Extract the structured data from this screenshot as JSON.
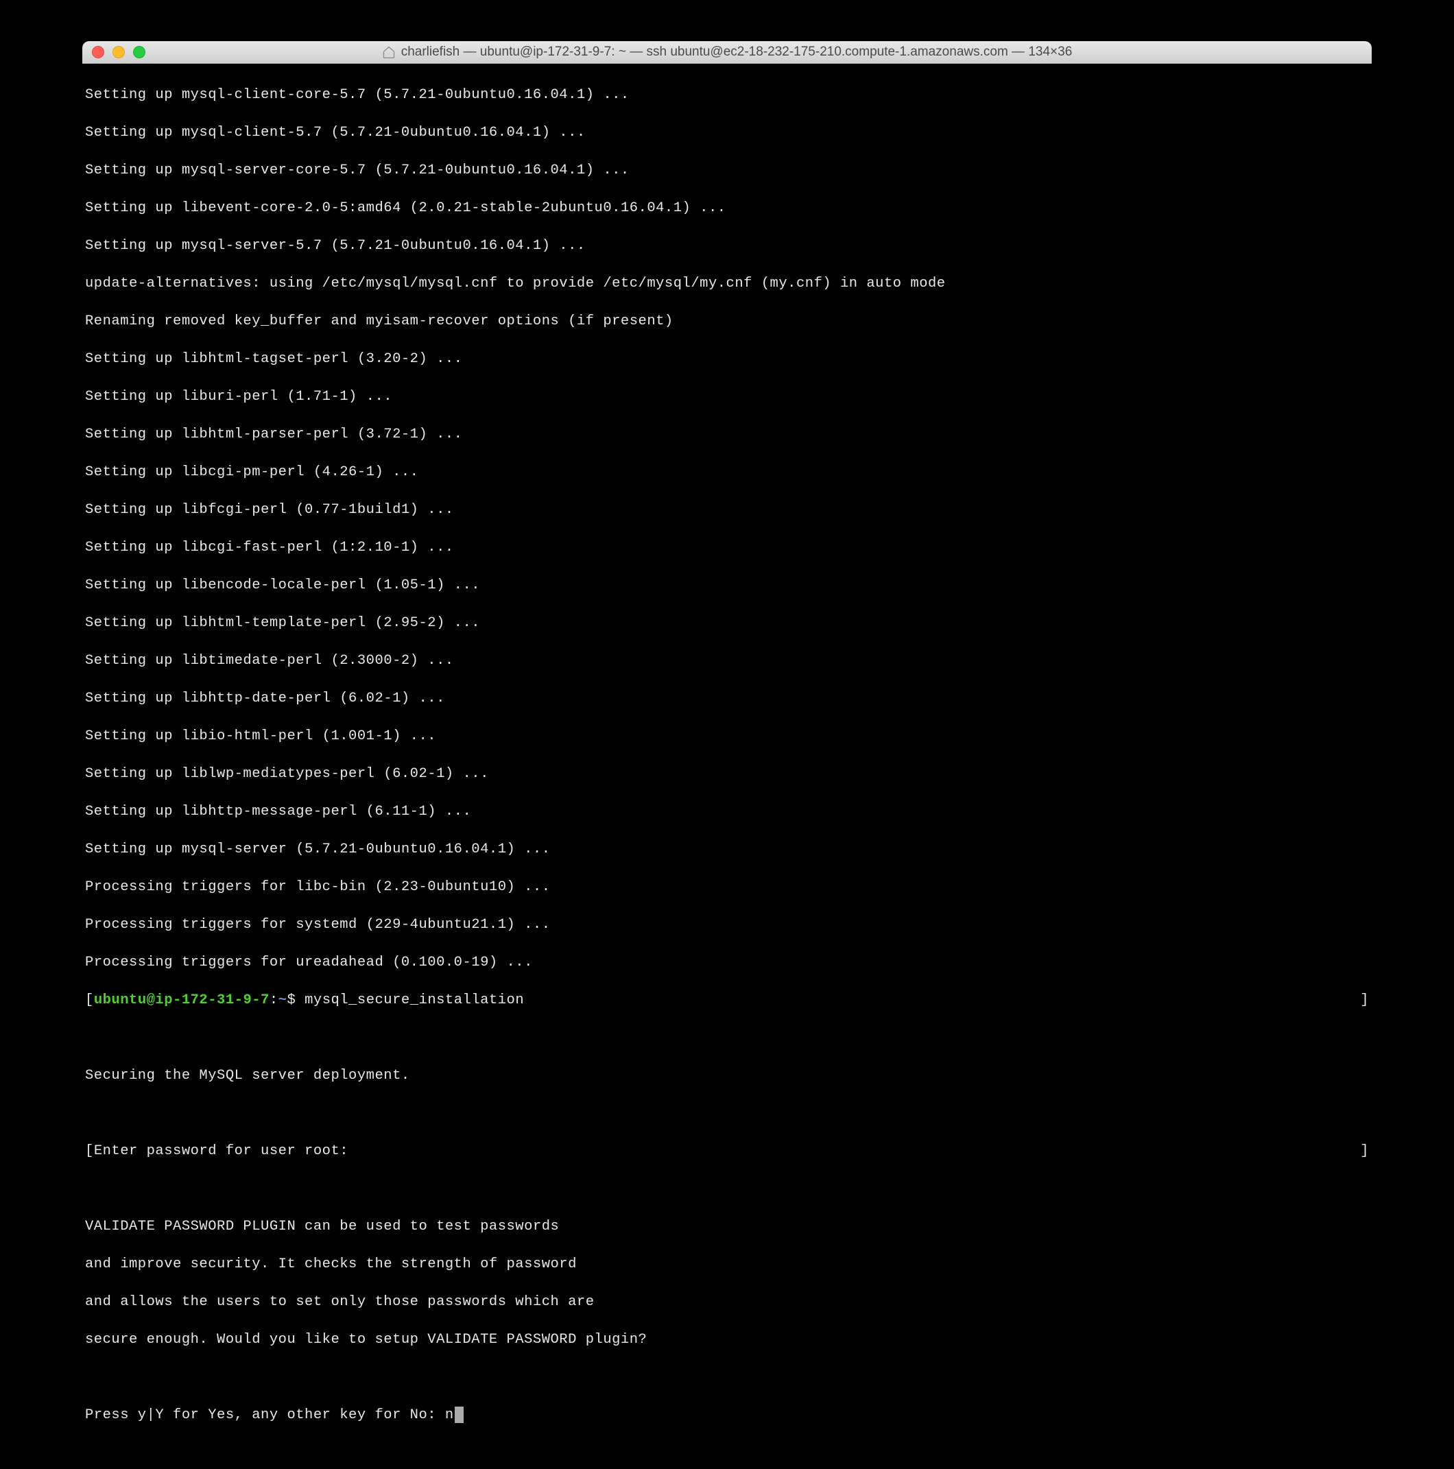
{
  "window": {
    "title": "charliefish — ubuntu@ip-172-31-9-7: ~ — ssh ubuntu@ec2-18-232-175-210.compute-1.amazonaws.com — 134×36"
  },
  "output": {
    "lines": [
      "Setting up mysql-client-core-5.7 (5.7.21-0ubuntu0.16.04.1) ...",
      "Setting up mysql-client-5.7 (5.7.21-0ubuntu0.16.04.1) ...",
      "Setting up mysql-server-core-5.7 (5.7.21-0ubuntu0.16.04.1) ...",
      "Setting up libevent-core-2.0-5:amd64 (2.0.21-stable-2ubuntu0.16.04.1) ...",
      "Setting up mysql-server-5.7 (5.7.21-0ubuntu0.16.04.1) ...",
      "update-alternatives: using /etc/mysql/mysql.cnf to provide /etc/mysql/my.cnf (my.cnf) in auto mode",
      "Renaming removed key_buffer and myisam-recover options (if present)",
      "Setting up libhtml-tagset-perl (3.20-2) ...",
      "Setting up liburi-perl (1.71-1) ...",
      "Setting up libhtml-parser-perl (3.72-1) ...",
      "Setting up libcgi-pm-perl (4.26-1) ...",
      "Setting up libfcgi-perl (0.77-1build1) ...",
      "Setting up libcgi-fast-perl (1:2.10-1) ...",
      "Setting up libencode-locale-perl (1.05-1) ...",
      "Setting up libhtml-template-perl (2.95-2) ...",
      "Setting up libtimedate-perl (2.3000-2) ...",
      "Setting up libhttp-date-perl (6.02-1) ...",
      "Setting up libio-html-perl (1.001-1) ...",
      "Setting up liblwp-mediatypes-perl (6.02-1) ...",
      "Setting up libhttp-message-perl (6.11-1) ...",
      "Setting up mysql-server (5.7.21-0ubuntu0.16.04.1) ...",
      "Processing triggers for libc-bin (2.23-0ubuntu10) ...",
      "Processing triggers for systemd (229-4ubuntu21.1) ...",
      "Processing triggers for ureadahead (0.100.0-19) ..."
    ]
  },
  "prompt": {
    "bracket_open": "[",
    "user_host": "ubuntu@ip-172-31-9-7",
    "colon": ":",
    "path": "~",
    "dollar": "$ ",
    "command": "mysql_secure_installation",
    "bracket_close": "]"
  },
  "securing": {
    "header": "Securing the MySQL server deployment.",
    "enter_pw_bracket_open": "[",
    "enter_pw": "Enter password for user root: ",
    "enter_pw_bracket_close": "]",
    "validate_lines": [
      "VALIDATE PASSWORD PLUGIN can be used to test passwords",
      "and improve security. It checks the strength of password",
      "and allows the users to set only those passwords which are",
      "secure enough. Would you like to setup VALIDATE PASSWORD plugin?"
    ],
    "press_prompt": "Press y|Y for Yes, any other key for No: ",
    "input": "n"
  }
}
